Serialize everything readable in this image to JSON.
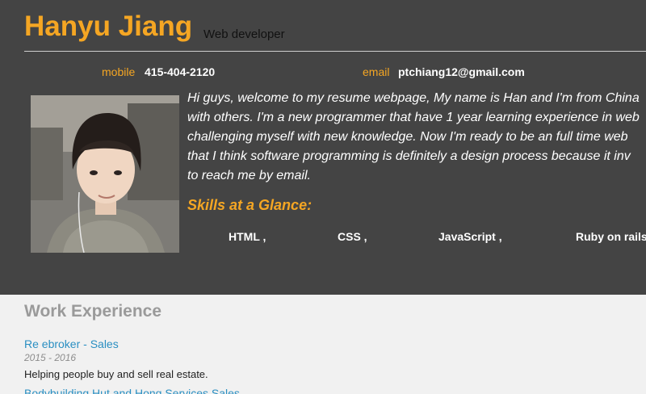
{
  "header": {
    "name": "Hanyu Jiang",
    "role": "Web developer"
  },
  "contact": {
    "mobile_label": "mobile",
    "mobile_value": "415-404-2120",
    "email_label": "email",
    "email_value": "ptchiang12@gmail.com"
  },
  "bio": {
    "lines": [
      " Hi guys, welcome to my resume webpage, My name is Han and I'm from China",
      "with others. I'm a new programmer that have 1 year learning experience in web",
      "challenging myself with new knowledge. Now I'm ready to be an full time web",
      "that I think software programming is definitely a design process because it inv",
      "to reach me by email."
    ]
  },
  "skills": {
    "heading": "Skills at a Glance:",
    "items": [
      "HTML ,",
      "CSS ,",
      "JavaScript ,",
      "Ruby on rails"
    ]
  },
  "work": {
    "title": "Work Experience",
    "jobs": [
      {
        "title": "Re ebroker - Sales",
        "dates": "2015 - 2016",
        "description": "Helping people buy and sell real estate."
      },
      {
        "title": "Bodybuilding Hut and Hong Services Sales"
      }
    ]
  },
  "colors": {
    "header_bg": "#444444",
    "accent": "#f5a623",
    "link": "#2a8fc2",
    "page_bg": "#f1f1f1"
  }
}
